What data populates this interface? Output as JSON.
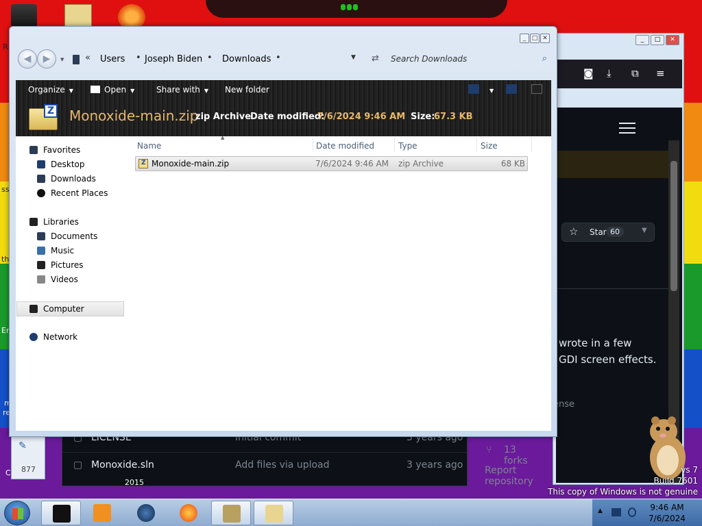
{
  "explorer": {
    "breadcrumb": [
      "Users",
      "Joseph Biden",
      "Downloads"
    ],
    "search_placeholder": "Search Downloads",
    "toolbar": {
      "organize": "Organize",
      "open": "Open",
      "share_with": "Share with",
      "new_folder": "New folder"
    },
    "details": {
      "name": "Monoxide-main.zip",
      "type": "zip Archive",
      "date_label": "Date modified:",
      "date_value": "7/6/2024 9:46 AM",
      "size_label": "Size:",
      "size_value": "67.3 KB"
    },
    "nav": {
      "favorites": "Favorites",
      "desktop": "Desktop",
      "downloads": "Downloads",
      "recent_places": "Recent Places",
      "libraries": "Libraries",
      "documents": "Documents",
      "music": "Music",
      "pictures": "Pictures",
      "videos": "Videos",
      "computer": "Computer",
      "network": "Network"
    },
    "columns": {
      "name": "Name",
      "date_modified": "Date modified",
      "type": "Type",
      "size": "Size"
    },
    "files": [
      {
        "name": "Monoxide-main.zip",
        "date": "7/6/2024 9:46 AM",
        "type": "zip Archive",
        "size": "68 KB"
      }
    ]
  },
  "browser": {
    "star_label": "Star",
    "star_count": "60",
    "description_line1": "wrote in a few",
    "description_line2": "GDI screen effects.",
    "license_fragment": "ense",
    "forks": "13 forks",
    "report": "Report repository",
    "files": [
      {
        "name": "LICENSE",
        "commit": "Initial commit",
        "time": "3 years ago"
      },
      {
        "name": "Monoxide.sln",
        "commit": "Add files via upload",
        "time": "3 years ago"
      }
    ]
  },
  "desktop": {
    "left_fragments": [
      "R",
      "ss",
      "th",
      "Er",
      "m",
      "re",
      "Cl"
    ],
    "small_window_count": "877",
    "bottom_label": "2015",
    "genuine_line1": "vs 7",
    "genuine_line2": "Build 7601",
    "genuine_line3": "This copy of Windows is not genuine"
  },
  "taskbar": {
    "time": "9:46 AM",
    "date": "7/6/2024"
  },
  "colors": {
    "accent": "#e8b86a",
    "toolbar_dark": "#1e1e1e",
    "github_bg": "#0d1117"
  }
}
